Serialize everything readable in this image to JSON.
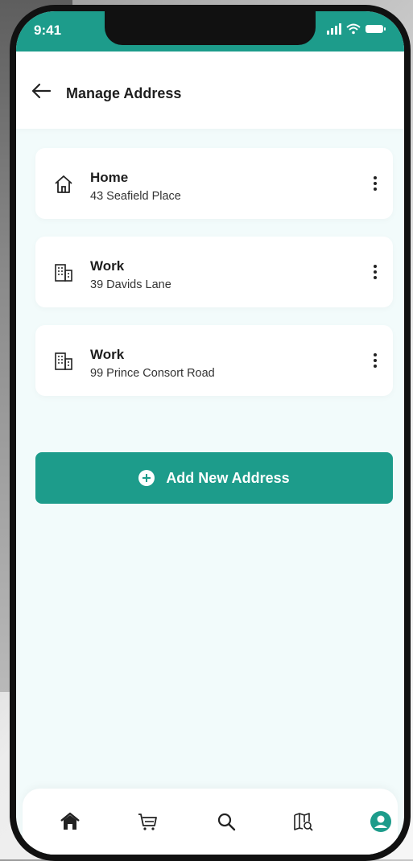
{
  "status": {
    "time": "9:41"
  },
  "header": {
    "title": "Manage Address",
    "back_icon": "arrow-left-icon"
  },
  "addresses": [
    {
      "label": "Home",
      "address": "43 Seafield Place",
      "icon": "home-icon"
    },
    {
      "label": "Work",
      "address": "39 Davids Lane",
      "icon": "building-icon"
    },
    {
      "label": "Work",
      "address": "99 Prince Consort Road",
      "icon": "building-icon"
    }
  ],
  "add_button": {
    "label": "Add New Address",
    "icon": "plus-circle-icon"
  },
  "nav": [
    {
      "icon": "home-icon",
      "active": false
    },
    {
      "icon": "cart-icon",
      "active": false
    },
    {
      "icon": "search-icon",
      "active": false
    },
    {
      "icon": "map-search-icon",
      "active": false
    },
    {
      "icon": "profile-icon",
      "active": true
    }
  ],
  "colors": {
    "accent": "#1d9c8b",
    "background": "#f2fbfb"
  }
}
